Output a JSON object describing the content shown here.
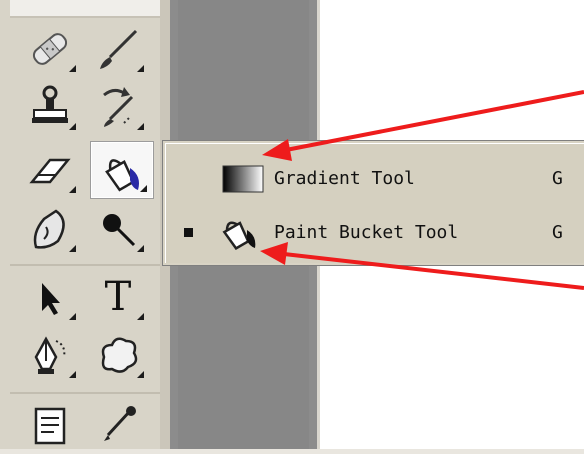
{
  "toolbar": {
    "tools": [
      {
        "icon": "healing-brush-icon"
      },
      {
        "icon": "brush-icon"
      },
      {
        "icon": "clone-stamp-icon"
      },
      {
        "icon": "history-brush-icon"
      },
      {
        "icon": "eraser-icon"
      },
      {
        "icon": "paint-bucket-icon",
        "active": true
      },
      {
        "icon": "blur-icon"
      },
      {
        "icon": "dodge-icon"
      },
      {
        "icon": "selection-arrow-icon"
      },
      {
        "icon": "type-icon",
        "label": "T"
      },
      {
        "icon": "pen-icon"
      },
      {
        "icon": "custom-shape-icon"
      },
      {
        "icon": "notes-icon"
      },
      {
        "icon": "eyedropper-icon"
      }
    ]
  },
  "flyout_menu": {
    "items": [
      {
        "label": "Gradient Tool",
        "shortcut": "G",
        "icon": "gradient-icon",
        "selected": false
      },
      {
        "label": "Paint Bucket Tool",
        "shortcut": "G",
        "icon": "paint-bucket-icon",
        "selected": true
      }
    ]
  },
  "annotation_color": "#ee1c1c"
}
